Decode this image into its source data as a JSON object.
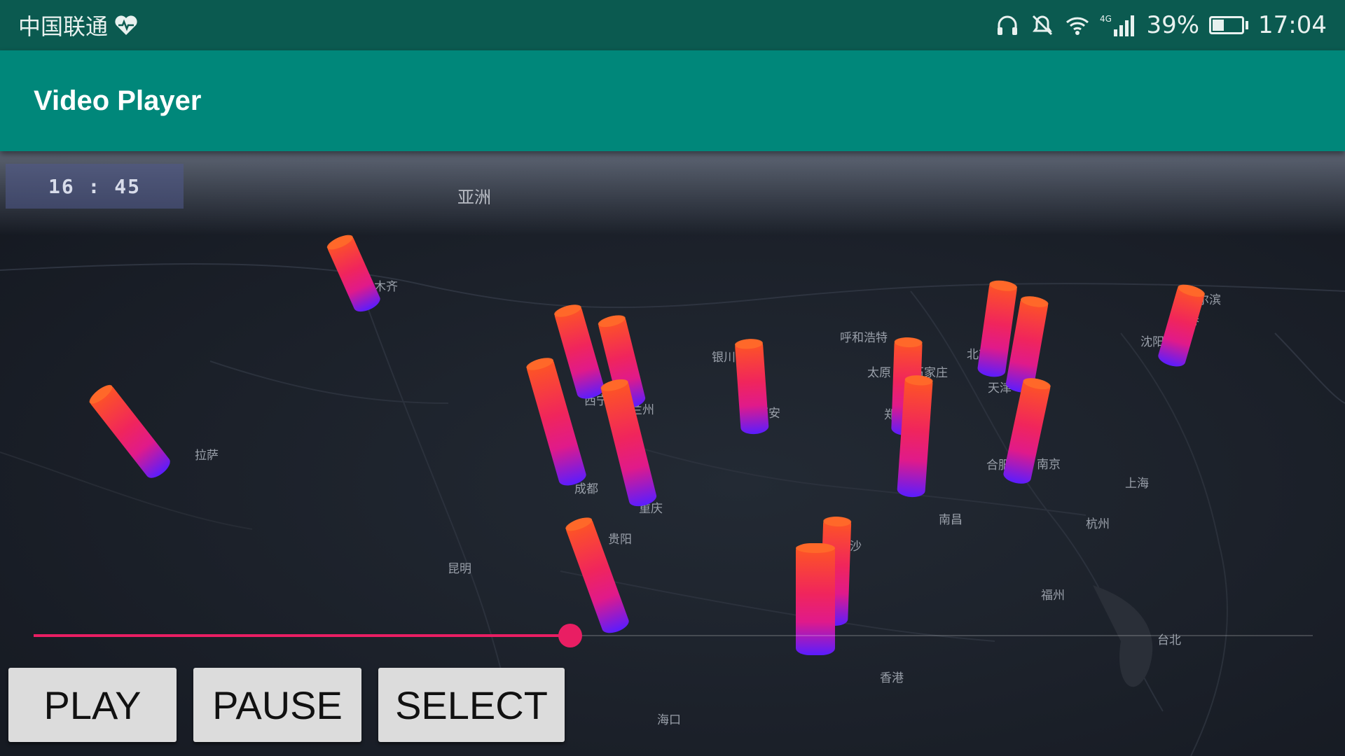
{
  "status_bar": {
    "carrier": "中国联通",
    "battery_percent": "39%",
    "battery_level": 0.39,
    "time": "17:04",
    "network": "4G",
    "icons": [
      "heart-pulse-icon",
      "headphones-icon",
      "mute-icon",
      "wifi-icon",
      "signal-icon",
      "battery-icon"
    ]
  },
  "app_bar": {
    "title": "Video Player"
  },
  "video": {
    "timestamp": "16 : 45",
    "region_label": "亚洲",
    "cities": [
      "乌鲁木齐",
      "西宁",
      "兰州",
      "银川",
      "呼和浩特",
      "太原",
      "石家庄",
      "天津",
      "哈尔滨",
      "长春",
      "沈阳",
      "成都",
      "重庆",
      "贵阳",
      "昆明",
      "长沙",
      "南昌",
      "南京",
      "上海",
      "杭州",
      "福州",
      "台北",
      "香港",
      "海口",
      "拉萨",
      "西安",
      "郑州",
      "合肥",
      "北京"
    ]
  },
  "seek_bar": {
    "progress": 0.4
  },
  "controls": {
    "play_label": "PLAY",
    "pause_label": "PAUSE",
    "select_label": "SELECT"
  },
  "colors": {
    "status_bar": "#0b5a50",
    "app_bar": "#00877a",
    "accent": "#e91e63",
    "bar_top": "#ff5a1e",
    "bar_bottom": "#5a1cff"
  }
}
